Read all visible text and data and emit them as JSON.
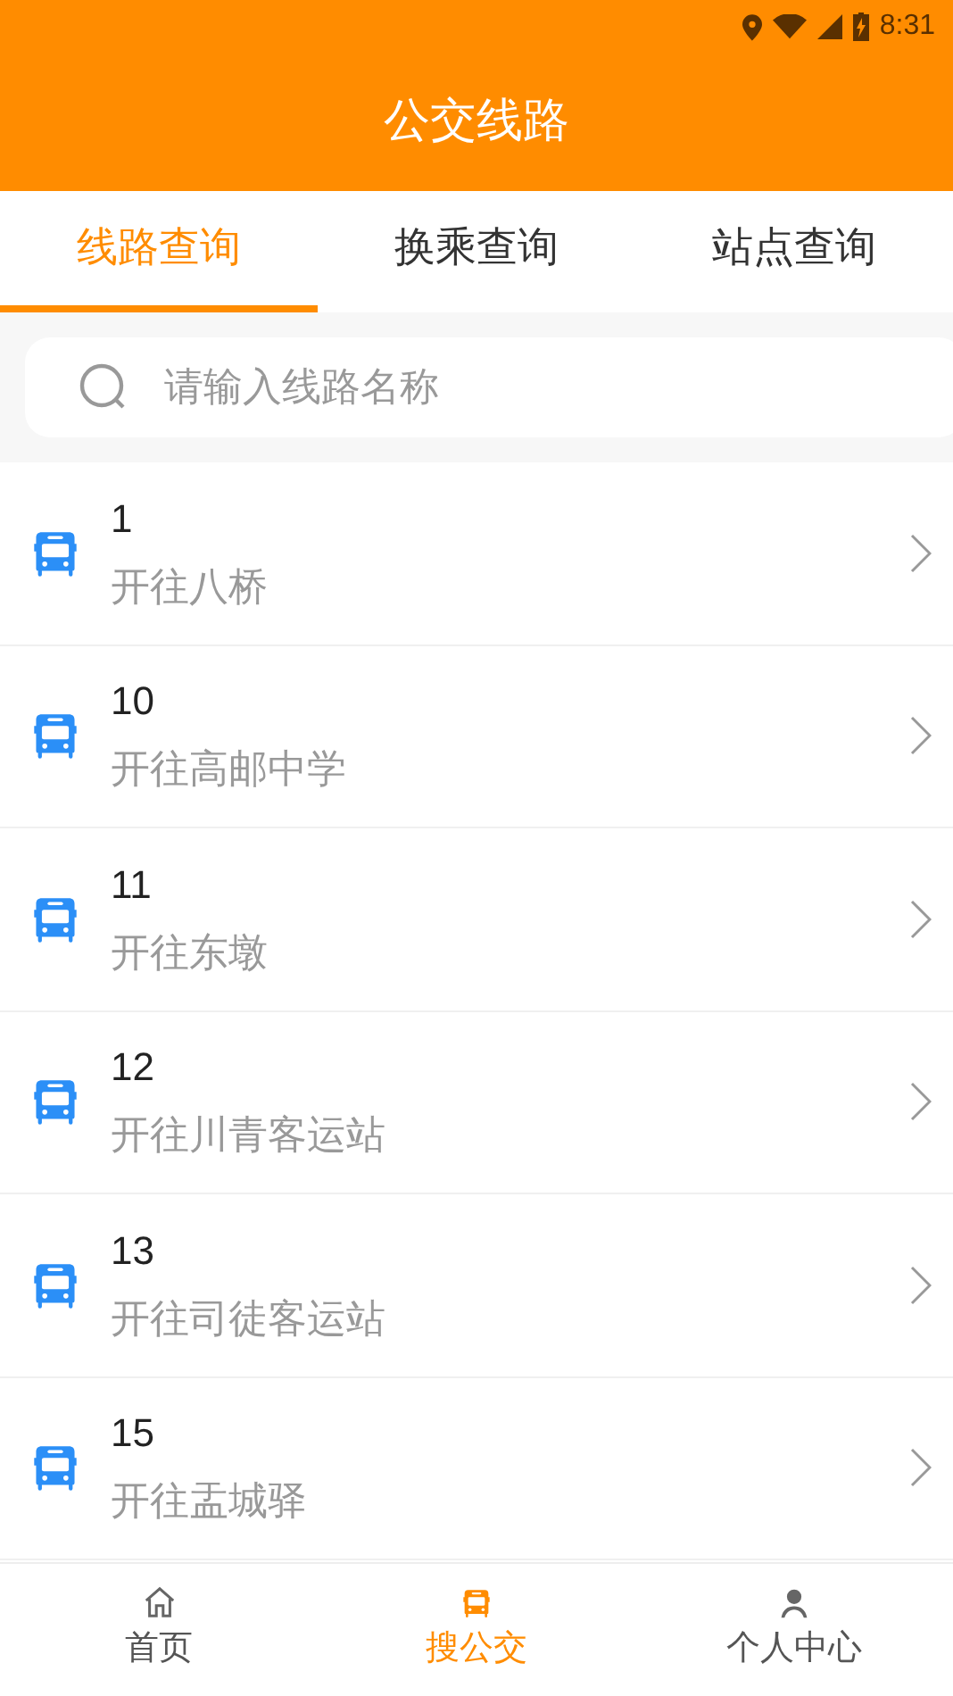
{
  "status_bar": {
    "time": "8:31"
  },
  "header": {
    "title": "公交线路"
  },
  "tabs": [
    {
      "label": "线路查询",
      "selected": true
    },
    {
      "label": "换乘查询",
      "selected": false
    },
    {
      "label": "站点查询",
      "selected": false
    }
  ],
  "search": {
    "placeholder": "请输入线路名称"
  },
  "routes": [
    {
      "number": "1",
      "destination": "开往八桥"
    },
    {
      "number": "10",
      "destination": "开往高邮中学"
    },
    {
      "number": "11",
      "destination": "开往东墩"
    },
    {
      "number": "12",
      "destination": "开往川青客运站"
    },
    {
      "number": "13",
      "destination": "开往司徒客运站"
    },
    {
      "number": "15",
      "destination": "开往盂城驿"
    }
  ],
  "bottom_nav": [
    {
      "kind": "home",
      "label": "首页",
      "selected": false
    },
    {
      "kind": "bus",
      "label": "搜公交",
      "selected": true
    },
    {
      "kind": "person",
      "label": "个人中心",
      "selected": false
    }
  ]
}
